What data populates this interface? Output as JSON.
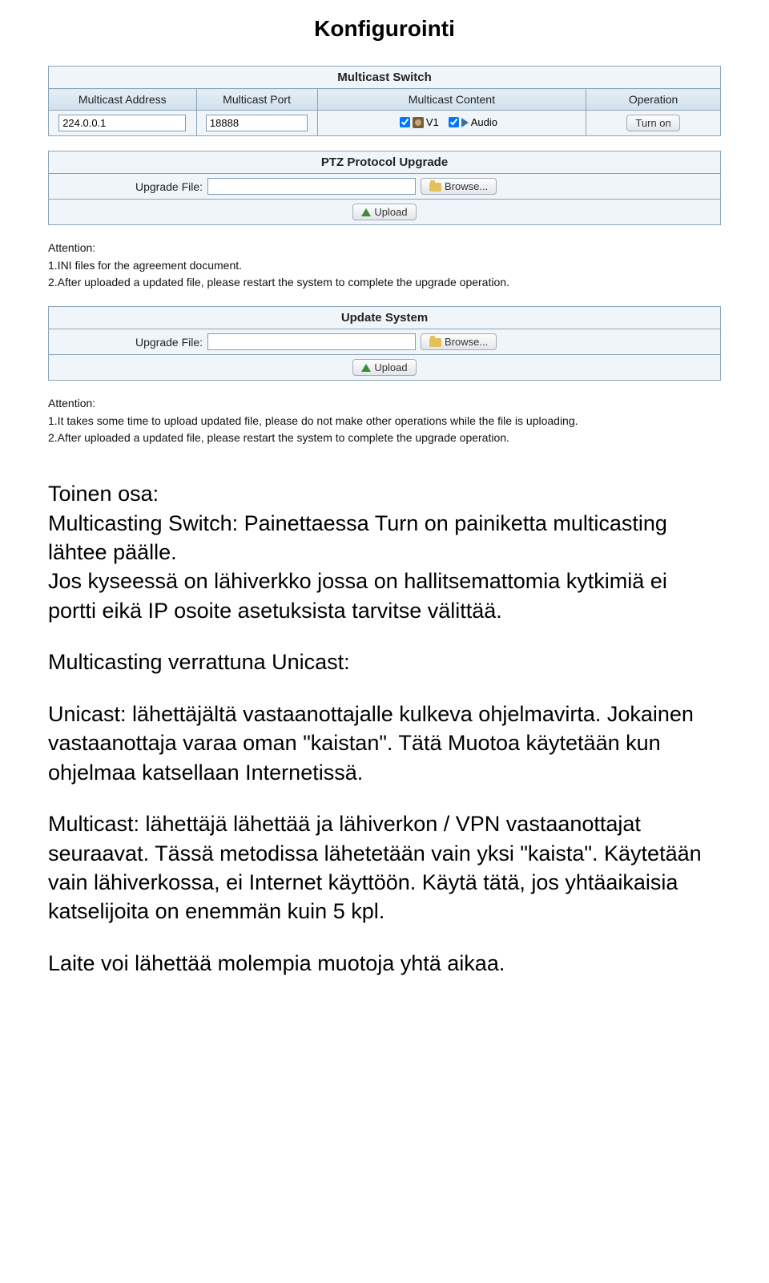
{
  "doc": {
    "title": "Konfigurointi"
  },
  "multicast": {
    "panel_title": "Multicast Switch",
    "headers": {
      "address": "Multicast Address",
      "port": "Multicast Port",
      "content": "Multicast Content",
      "operation": "Operation"
    },
    "values": {
      "address": "224.0.0.1",
      "port": "18888",
      "v1": "V1",
      "audio": "Audio"
    },
    "turn_on": "Turn on"
  },
  "ptz": {
    "panel_title": "PTZ Protocol Upgrade",
    "upgrade_file_label": "Upgrade File:",
    "browse": "Browse...",
    "upload": "Upload",
    "attention_title": "Attention:",
    "attention1": "1.INI files for the agreement document.",
    "attention2": "2.After uploaded a updated file, please restart the system to complete the upgrade operation."
  },
  "update": {
    "panel_title": "Update System",
    "upgrade_file_label": "Upgrade File:",
    "browse": "Browse...",
    "upload": "Upload",
    "attention_title": "Attention:",
    "attention1": "1.It takes some time to upload updated file, please do not make other operations while the file is uploading.",
    "attention2": "2.After uploaded a updated file, please restart the system to complete the upgrade operation."
  },
  "text": {
    "p1": "Toinen osa:",
    "p2": "Multicasting Switch: Painettaessa Turn on painiketta multicasting lähtee päälle.",
    "p3": "Jos kyseessä on lähiverkko jossa on hallitsemattomia kytkimiä ei portti eikä IP osoite asetuksista tarvitse välittää.",
    "p4": "Multicasting verrattuna Unicast:",
    "p5": "Unicast: lähettäjältä vastaanottajalle kulkeva ohjelmavirta. Jokainen vastaanottaja varaa oman \"kaistan\". Tätä Muotoa käytetään kun ohjelmaa katsellaan Internetissä.",
    "p6": "Multicast: lähettäjä lähettää ja lähiverkon / VPN vastaanottajat seuraavat. Tässä metodissa lähetetään vain yksi \"kaista\". Käytetään vain lähiverkossa, ei Internet käyttöön. Käytä tätä, jos yhtäaikaisia katselijoita on enemmän kuin 5 kpl.",
    "p7": "Laite voi lähettää molempia muotoja yhtä aikaa."
  }
}
